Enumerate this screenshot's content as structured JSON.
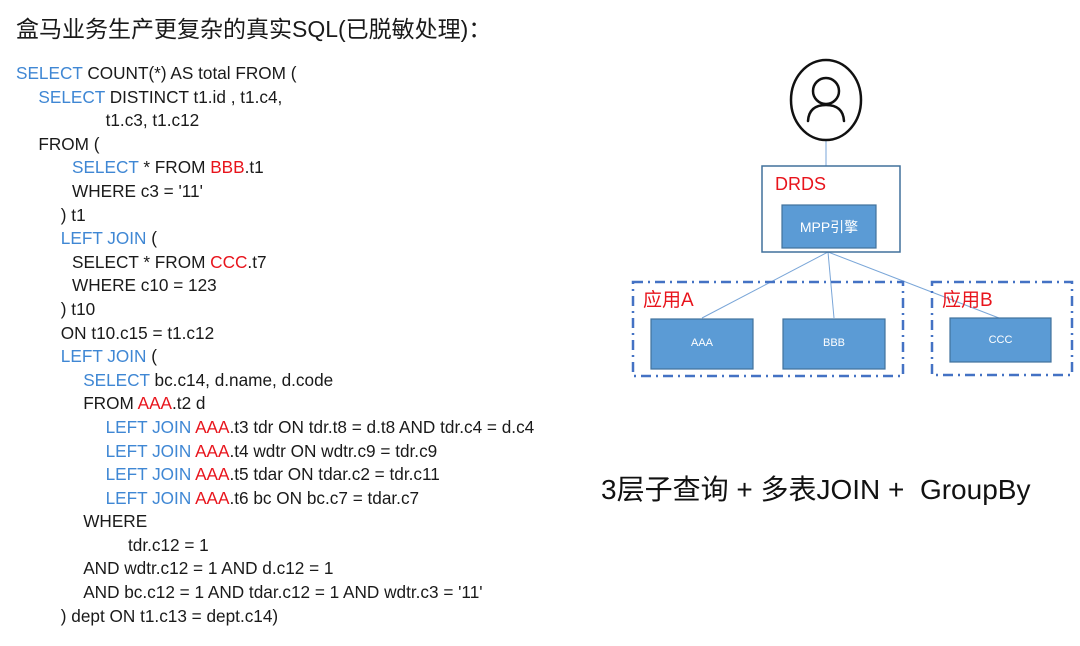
{
  "title": "盒马业务生产更复杂的真实SQL(已脱敏处理)：",
  "colors": {
    "keyword": "#3f87d4",
    "database": "#e8141c",
    "text": "#1a1a1a",
    "node_fill": "#5b9bd5",
    "node_border": "#41719c",
    "dashed_border": "#4472c4",
    "connector": "#7aa6d8"
  },
  "sql": {
    "lines": [
      {
        "indent": 0,
        "parts": [
          {
            "t": "SELECT",
            "s": "kw"
          },
          {
            "t": " COUNT(*) AS total FROM (",
            "s": ""
          }
        ]
      },
      {
        "indent": 1,
        "parts": [
          {
            "t": "SELECT",
            "s": "kw"
          },
          {
            "t": " DISTINCT t1.id , t1.c4,",
            "s": ""
          }
        ]
      },
      {
        "indent": 4,
        "parts": [
          {
            "t": "t1.c3, t1.c12",
            "s": ""
          }
        ]
      },
      {
        "indent": 1,
        "parts": [
          {
            "t": "FROM (",
            "s": ""
          }
        ]
      },
      {
        "indent": 2.5,
        "parts": [
          {
            "t": "SELECT",
            "s": "kw"
          },
          {
            "t": " * FROM ",
            "s": ""
          },
          {
            "t": "BBB",
            "s": "db"
          },
          {
            "t": ".t1",
            "s": ""
          }
        ]
      },
      {
        "indent": 2.5,
        "parts": [
          {
            "t": "WHERE c3 = '11'",
            "s": ""
          }
        ]
      },
      {
        "indent": 2,
        "parts": [
          {
            "t": ") t1",
            "s": ""
          }
        ]
      },
      {
        "indent": 2,
        "parts": [
          {
            "t": "LEFT JOIN",
            "s": "kw"
          },
          {
            "t": " (",
            "s": ""
          }
        ]
      },
      {
        "indent": 2.5,
        "parts": [
          {
            "t": "SELECT * FROM ",
            "s": ""
          },
          {
            "t": "CCC",
            "s": "db"
          },
          {
            "t": ".t7",
            "s": ""
          }
        ]
      },
      {
        "indent": 2.5,
        "parts": [
          {
            "t": "WHERE c10 = 123",
            "s": ""
          }
        ]
      },
      {
        "indent": 2,
        "parts": [
          {
            "t": ") t10",
            "s": ""
          }
        ]
      },
      {
        "indent": 2,
        "parts": [
          {
            "t": "ON t10.c15 = t1.c12",
            "s": ""
          }
        ]
      },
      {
        "indent": 2,
        "parts": [
          {
            "t": "LEFT JOIN",
            "s": "kw"
          },
          {
            "t": " (",
            "s": ""
          }
        ]
      },
      {
        "indent": 3,
        "parts": [
          {
            "t": "SELECT",
            "s": "kw"
          },
          {
            "t": " bc.c14, d.name, d.code",
            "s": ""
          }
        ]
      },
      {
        "indent": 3,
        "parts": [
          {
            "t": "FROM ",
            "s": ""
          },
          {
            "t": "AAA",
            "s": "db"
          },
          {
            "t": ".t2 d",
            "s": ""
          }
        ]
      },
      {
        "indent": 4,
        "parts": [
          {
            "t": "LEFT JOIN",
            "s": "kw"
          },
          {
            "t": " ",
            "s": ""
          },
          {
            "t": "AAA",
            "s": "db"
          },
          {
            "t": ".t3 tdr ON tdr.t8 = d.t8 AND tdr.c4 = d.c4",
            "s": ""
          }
        ]
      },
      {
        "indent": 4,
        "parts": [
          {
            "t": "LEFT JOIN",
            "s": "kw"
          },
          {
            "t": " ",
            "s": ""
          },
          {
            "t": "AAA",
            "s": "db"
          },
          {
            "t": ".t4 wdtr ON wdtr.c9 = tdr.c9",
            "s": ""
          }
        ]
      },
      {
        "indent": 4,
        "parts": [
          {
            "t": "LEFT JOIN",
            "s": "kw"
          },
          {
            "t": " ",
            "s": ""
          },
          {
            "t": "AAA",
            "s": "db"
          },
          {
            "t": ".t5 tdar ON tdar.c2 = tdr.c11",
            "s": ""
          }
        ]
      },
      {
        "indent": 4,
        "parts": [
          {
            "t": "LEFT JOIN",
            "s": "kw"
          },
          {
            "t": " ",
            "s": ""
          },
          {
            "t": "AAA",
            "s": "db"
          },
          {
            "t": ".t6 bc ON bc.c7 = tdar.c7",
            "s": ""
          }
        ]
      },
      {
        "indent": 3,
        "parts": [
          {
            "t": "WHERE",
            "s": ""
          }
        ]
      },
      {
        "indent": 5,
        "parts": [
          {
            "t": "tdr.c12 = 1",
            "s": ""
          }
        ]
      },
      {
        "indent": 3,
        "parts": [
          {
            "t": "AND wdtr.c12 = 1 AND d.c12 = 1",
            "s": ""
          }
        ]
      },
      {
        "indent": 3,
        "parts": [
          {
            "t": "AND bc.c12 = 1 AND tdar.c12 = 1 AND wdtr.c3 = '11'",
            "s": ""
          }
        ]
      },
      {
        "indent": 2,
        "parts": [
          {
            "t": ") dept ON t1.c13 = dept.c14)",
            "s": ""
          }
        ]
      }
    ]
  },
  "diagram": {
    "user_icon": "user-icon",
    "drds_label": "DRDS",
    "engine_label": "MPP引擎",
    "groups": [
      {
        "label": "应用A",
        "nodes": [
          "AAA",
          "BBB"
        ]
      },
      {
        "label": "应用B",
        "nodes": [
          "CCC"
        ]
      }
    ],
    "caption": "3层子查询 + 多表JOIN +  GroupBy"
  }
}
